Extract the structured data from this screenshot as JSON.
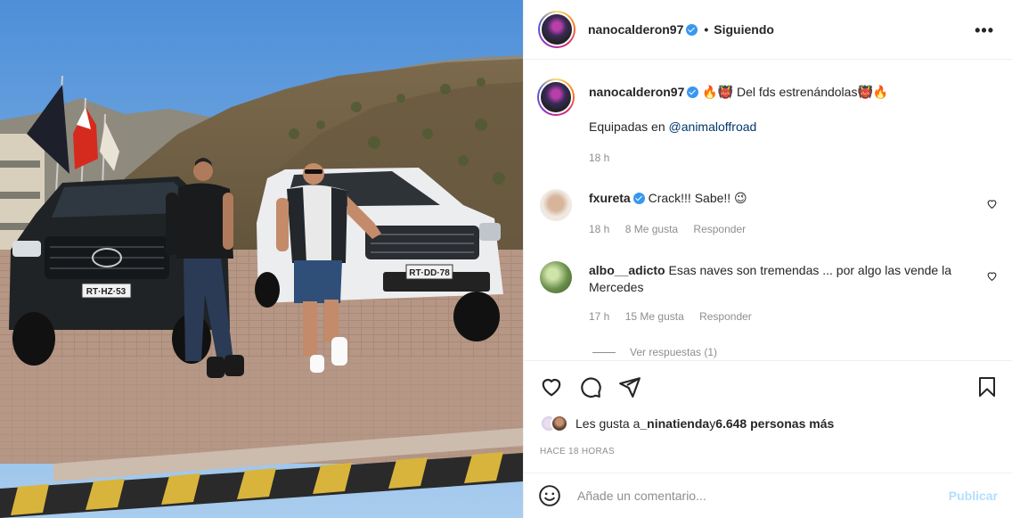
{
  "post": {
    "username": "nanocalderon97",
    "follow_status": "Siguiendo",
    "separator": "•",
    "more_label": "•••"
  },
  "caption": {
    "username": "nanocalderon97",
    "text_prefix": "🔥👹",
    "text": "Del fds estrenándolas",
    "text_suffix": "👹🔥",
    "line2_prefix": "Equipadas en ",
    "mention": "@animaloffroad",
    "time": "18 h"
  },
  "comments": [
    {
      "username": "fxureta",
      "verified": true,
      "text": "Crack!!! Sabe!! 😉",
      "time": "18 h",
      "likes": "8 Me gusta",
      "reply": "Responder"
    },
    {
      "username": "albo__adicto",
      "verified": false,
      "text": "Esas naves son tremendas ... por algo las vende la Mercedes",
      "time": "17 h",
      "likes": "15 Me gusta",
      "reply": "Responder"
    }
  ],
  "view_replies": "Ver respuestas (1)",
  "likes_summary": {
    "prefix": "Les gusta a ",
    "user": "_ninatienda",
    "middle": " y ",
    "count": "6.648 personas más"
  },
  "timestamp": "HACE 18 HORAS",
  "composer": {
    "placeholder": "Añade un comentario...",
    "publish": "Publicar"
  },
  "photo": {
    "plate_left": "RT·HZ·53",
    "plate_right": "RT·DD·78"
  },
  "icons": [
    "heart-icon",
    "comment-icon",
    "share-icon",
    "bookmark-icon",
    "emoji-icon",
    "verified-icon",
    "more-icon"
  ],
  "colors": {
    "verified": "#3897f0",
    "link": "#00376b",
    "muted": "#8e8e8e",
    "publish_disabled": "#b2dffc"
  }
}
